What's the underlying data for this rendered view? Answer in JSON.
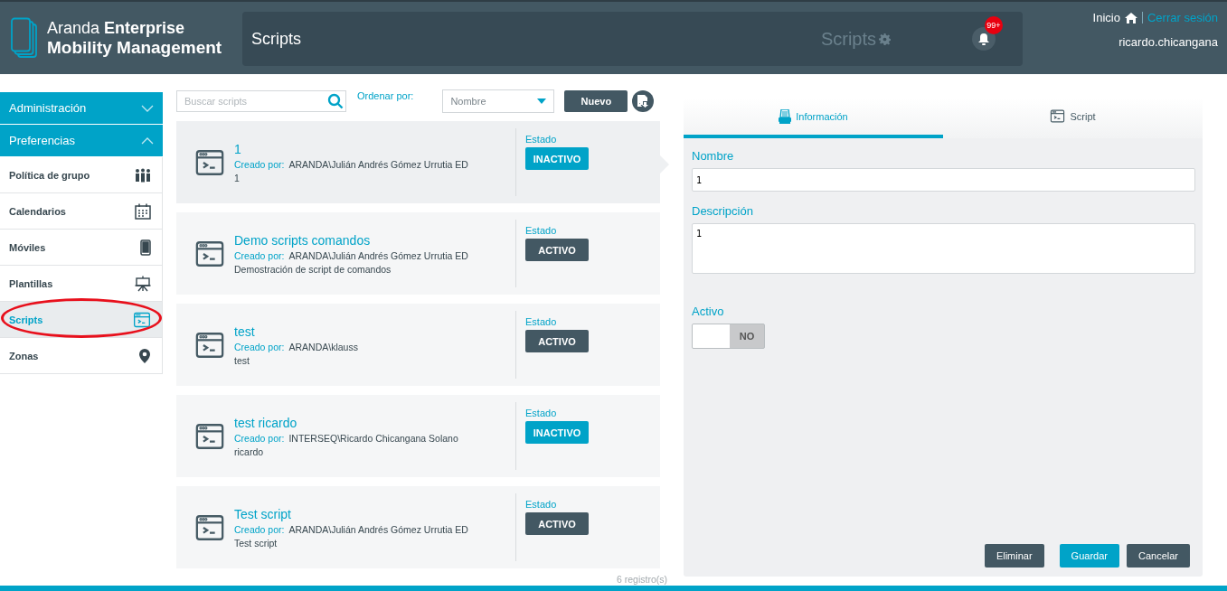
{
  "header": {
    "brand_light": "Aranda",
    "brand_bold": "Enterprise",
    "brand_line2": "Mobility Management",
    "page_title": "Scripts",
    "ghost_title": "Scripts",
    "notification_count": "99+",
    "home_link": "Inicio",
    "logout_link": "Cerrar sesión",
    "user": "ricardo.chicangana"
  },
  "sidebar": {
    "sections": [
      {
        "label": "Administración",
        "expanded": false
      },
      {
        "label": "Preferencias",
        "expanded": true
      }
    ],
    "items": [
      {
        "label": "Política de grupo",
        "selected": false
      },
      {
        "label": "Calendarios",
        "selected": false
      },
      {
        "label": "Móviles",
        "selected": false
      },
      {
        "label": "Plantillas",
        "selected": false
      },
      {
        "label": "Scripts",
        "selected": true,
        "circled": true
      },
      {
        "label": "Zonas",
        "selected": false
      }
    ]
  },
  "toolbar": {
    "search_placeholder": "Buscar scripts",
    "sort_label": "Ordenar por:",
    "sort_value": "Nombre",
    "new_button": "Nuevo"
  },
  "scripts": [
    {
      "name": "1",
      "creator_label": "Creado por:",
      "creator": "ARANDA\\Julián Andrés Gómez Urrutia ED",
      "description": "1",
      "status_label": "Estado",
      "status": "INACTIVO",
      "active": false,
      "selected": true
    },
    {
      "name": "Demo scripts comandos",
      "creator_label": "Creado por:",
      "creator": "ARANDA\\Julián Andrés Gómez Urrutia ED",
      "description": "Demostración de script de comandos",
      "status_label": "Estado",
      "status": "ACTIVO",
      "active": true,
      "selected": false
    },
    {
      "name": "test",
      "creator_label": "Creado por:",
      "creator": "ARANDA\\klauss",
      "description": "test",
      "status_label": "Estado",
      "status": "ACTIVO",
      "active": true,
      "selected": false
    },
    {
      "name": "test ricardo",
      "creator_label": "Creado por:",
      "creator": "INTERSEQ\\Ricardo Chicangana Solano",
      "description": "ricardo",
      "status_label": "Estado",
      "status": "INACTIVO",
      "active": false,
      "selected": false
    },
    {
      "name": "Test script",
      "creator_label": "Creado por:",
      "creator": "ARANDA\\Julián Andrés Gómez Urrutia ED",
      "description": "Test script",
      "status_label": "Estado",
      "status": "ACTIVO",
      "active": true,
      "selected": false
    }
  ],
  "record_count": "6 registro(s)",
  "detail": {
    "tabs": [
      {
        "label": "Información",
        "selected": true
      },
      {
        "label": "Script",
        "selected": false
      }
    ],
    "name_label": "Nombre",
    "name_value": "1",
    "description_label": "Descripción",
    "description_value": "1",
    "active_label": "Activo",
    "active_toggle": {
      "on": false,
      "label": "NO"
    },
    "buttons": [
      {
        "label": "Eliminar",
        "kind": "secondary"
      },
      {
        "label": "Guardar",
        "kind": "primary"
      },
      {
        "label": "Cancelar",
        "kind": "secondary"
      }
    ]
  }
}
